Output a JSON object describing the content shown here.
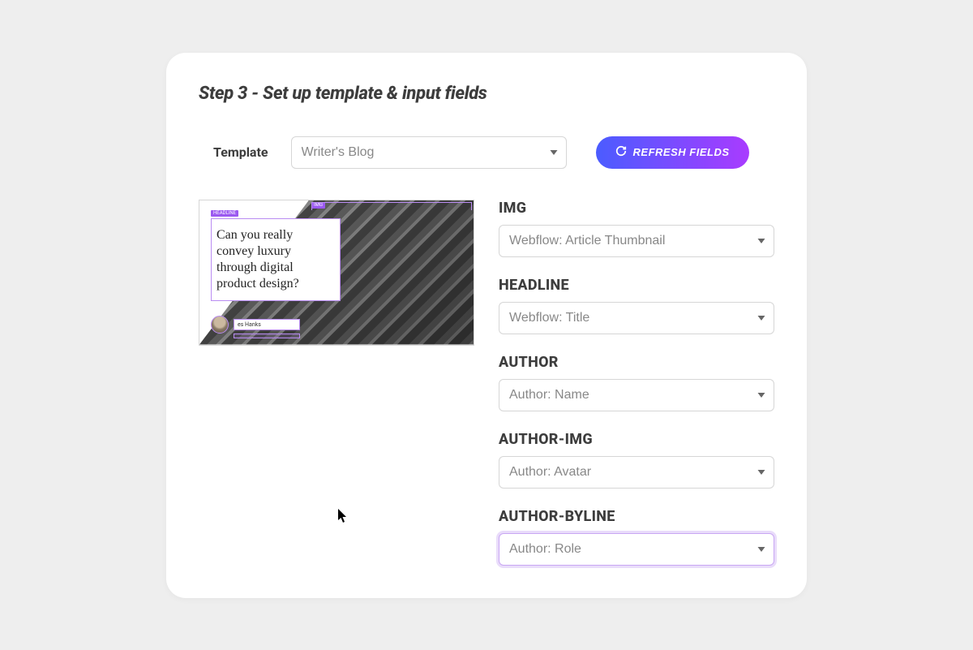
{
  "step_title": "Step 3 - Set up template & input fields",
  "template": {
    "label": "Template",
    "selected": "Writer's Blog"
  },
  "refresh_button": "REFRESH FIELDS",
  "preview": {
    "headline": "Can you really convey luxury through digital product design?",
    "author_name": "es Hanks",
    "tags": {
      "top": "HEADLINE",
      "img": "IMG"
    }
  },
  "fields": [
    {
      "label": "IMG",
      "value": "Webflow: Article Thumbnail",
      "focused": false
    },
    {
      "label": "HEADLINE",
      "value": "Webflow: Title",
      "focused": false
    },
    {
      "label": "AUTHOR",
      "value": "Author: Name",
      "focused": false
    },
    {
      "label": "AUTHOR-IMG",
      "value": "Author: Avatar",
      "focused": false
    },
    {
      "label": "AUTHOR-BYLINE",
      "value": "Author: Role",
      "focused": true
    }
  ]
}
